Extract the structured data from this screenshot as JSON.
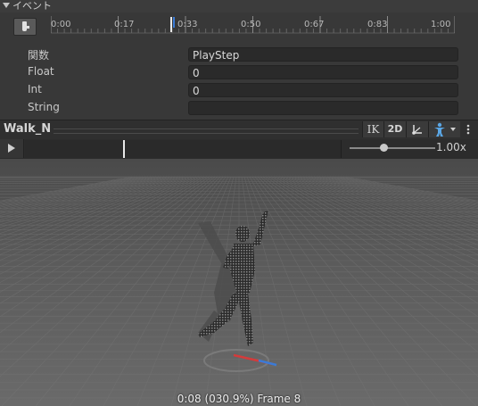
{
  "events_section": {
    "title": "イベント",
    "timeline_ticks": [
      "0:00",
      "0:17",
      "0:33",
      "0:50",
      "0:67",
      "0:83",
      "1:00"
    ],
    "fields": [
      {
        "label": "関数",
        "value": "PlayStep"
      },
      {
        "label": "Float",
        "value": "0"
      },
      {
        "label": "Int",
        "value": "0"
      },
      {
        "label": "String",
        "value": ""
      }
    ]
  },
  "preview": {
    "clip_name": "Walk_N",
    "ik_label": "IK",
    "mode_2d_label": "2D",
    "speed": "1.00x",
    "speed_fraction": 0.4,
    "playhead_fraction": 0.31,
    "frame_readout": "0:08 (030.9%) Frame 8"
  },
  "icons": {
    "add_event": "add-event-icon",
    "play": "play-icon",
    "pivot": "pivot-icon",
    "avatar": "avatar-icon",
    "more": "more-icon"
  },
  "colors": {
    "accent_blue": "#3b7bd6",
    "axis_red": "#d43b3b"
  }
}
